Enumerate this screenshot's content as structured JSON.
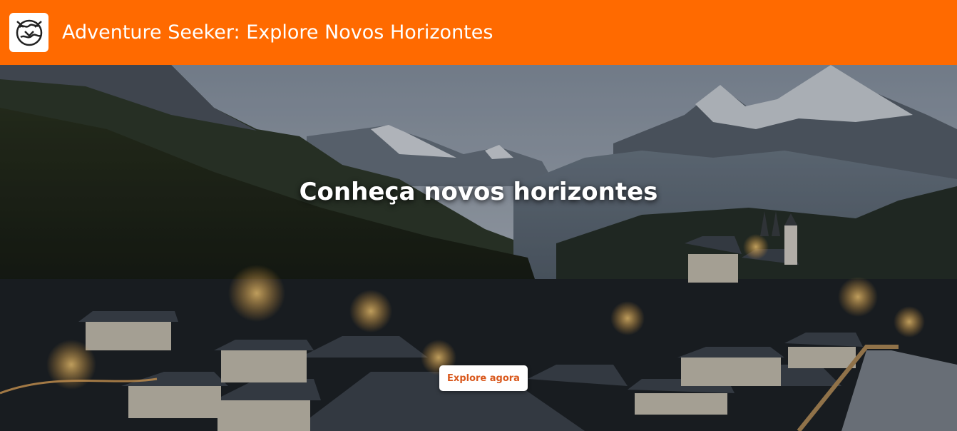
{
  "header": {
    "title": "Adventure Seeker: Explore Novos Horizontes",
    "logo_icon": "globe-handshake-icon"
  },
  "hero": {
    "heading": "Conheça novos horizontes",
    "cta_label": "Explore agora",
    "image": "mountain-village-at-dusk"
  },
  "colors": {
    "brand": "#ff6a00",
    "cta_text": "#d9581c",
    "cta_bg": "#ffffff"
  }
}
